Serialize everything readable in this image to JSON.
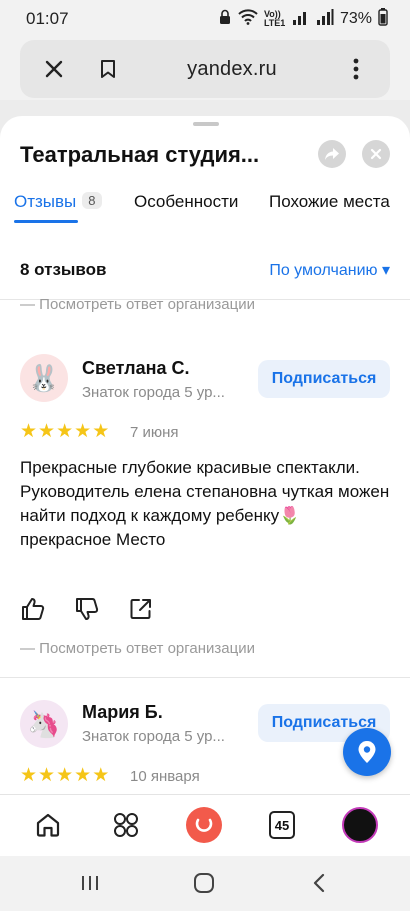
{
  "status_bar": {
    "time": "01:07",
    "battery": "73%",
    "network": "Vo)) LTE1"
  },
  "browser": {
    "url": "yandex.ru"
  },
  "header": {
    "title": "Театральная студия..."
  },
  "tabs": [
    {
      "label": "Отзывы",
      "count": "8"
    },
    {
      "label": "Особенности"
    },
    {
      "label": "Похожие места"
    }
  ],
  "reviews_header": {
    "count_label": "8 отзывов",
    "sort_label": "По умолчанию ▾"
  },
  "org_reply_link": "— Посмотреть ответ организации",
  "subscribe_label": "Подписаться",
  "reviews": [
    {
      "author": "Светлана С.",
      "subtitle": "Знаток города 5 ур...",
      "rating": 5,
      "date": "7 июня",
      "text": "Прекрасные глубокие красивые спектакли. Руководитель елена степановна чуткая можен найти подход к каждому ребенку🌷 прекрасное Место",
      "avatar_emoji": "🐰"
    },
    {
      "author": "Мария Б.",
      "subtitle": "Знаток города 5 ур...",
      "rating": 5,
      "date": "10 января",
      "avatar_emoji": "🦄"
    }
  ],
  "bottom_nav": {
    "tabs_count": "45"
  },
  "colors": {
    "accent": "#1a73e8",
    "star": "#f5c518",
    "alice": "#f25a4b"
  }
}
